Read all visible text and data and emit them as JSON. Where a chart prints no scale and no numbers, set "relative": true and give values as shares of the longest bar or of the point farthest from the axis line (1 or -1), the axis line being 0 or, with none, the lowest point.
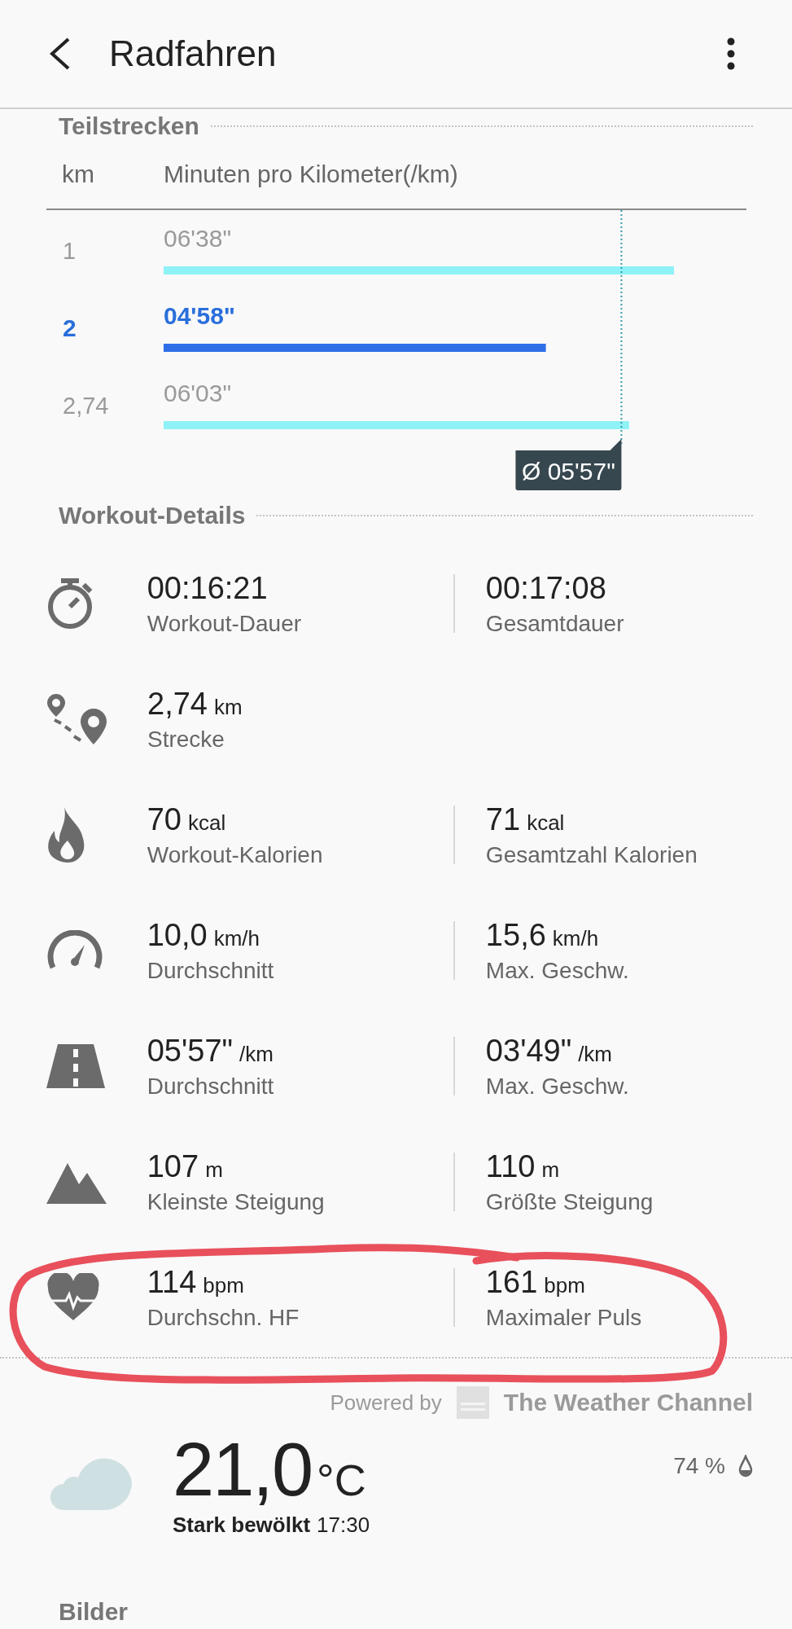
{
  "app_bar": {
    "title": "Radfahren"
  },
  "splits": {
    "title": "Teilstrecken",
    "columns": [
      "km",
      "Minuten pro Kilometer(/km)"
    ],
    "rows": [
      {
        "pace": "06'38\"",
        "selected": false
      },
      {
        "pace": "04'58\"",
        "selected": true
      },
      {
        "pace": "06'03\"",
        "selected": false
      }
    ],
    "chart_data": {
      "type": "bar",
      "orientation": "horizontal",
      "relative": true,
      "categories": [
        "1",
        "2",
        "2,74"
      ],
      "values": [
        1,
        0.749,
        0.912
      ],
      "ref_lines": [
        {
          "axis": "x",
          "value": 0.897,
          "label": "Ø 05'57\""
        }
      ]
    }
  },
  "details": {
    "title": "Workout-Details",
    "rows": [
      {
        "kind": "duration",
        "cells": [
          {
            "value": "00:16:21",
            "label": "Workout-Dauer"
          },
          {
            "value": "00:17:08",
            "label": "Gesamtdauer"
          }
        ]
      },
      {
        "kind": "distance",
        "cells": [
          {
            "value": "2,74",
            "unit": "km",
            "label": "Strecke"
          }
        ]
      },
      {
        "kind": "calories",
        "cells": [
          {
            "value": "70",
            "unit": "kcal",
            "label": "Workout-Kalorien"
          },
          {
            "value": "71",
            "unit": "kcal",
            "label": "Gesamtzahl Kalorien"
          }
        ]
      },
      {
        "kind": "speed",
        "cells": [
          {
            "value": "10,0",
            "unit": "km/h",
            "label": "Durchschnitt"
          },
          {
            "value": "15,6",
            "unit": "km/h",
            "label": "Max. Geschw."
          }
        ]
      },
      {
        "kind": "pace",
        "cells": [
          {
            "value": "05'57\"",
            "unit": "/km",
            "label": "Durchschnitt"
          },
          {
            "value": "03'49\"",
            "unit": "/km",
            "label": "Max. Geschw."
          }
        ]
      },
      {
        "kind": "altitude",
        "cells": [
          {
            "value": "107",
            "unit": "m",
            "label": "Kleinste Steigung"
          },
          {
            "value": "110",
            "unit": "m",
            "label": "Größte Steigung"
          }
        ]
      },
      {
        "kind": "heart_rate",
        "cells": [
          {
            "value": "114",
            "unit": "bpm",
            "label": "Durchschn. HF"
          },
          {
            "value": "161",
            "unit": "bpm",
            "label": "Maximaler Puls"
          }
        ]
      }
    ]
  },
  "weather": {
    "powered_by": "Powered by",
    "provider": "The Weather Channel",
    "temperature": "21,0",
    "unit": "°C",
    "condition": "Stark bewölkt",
    "time": "17:30",
    "humidity": "74 %"
  },
  "images": {
    "title": "Bilder"
  }
}
